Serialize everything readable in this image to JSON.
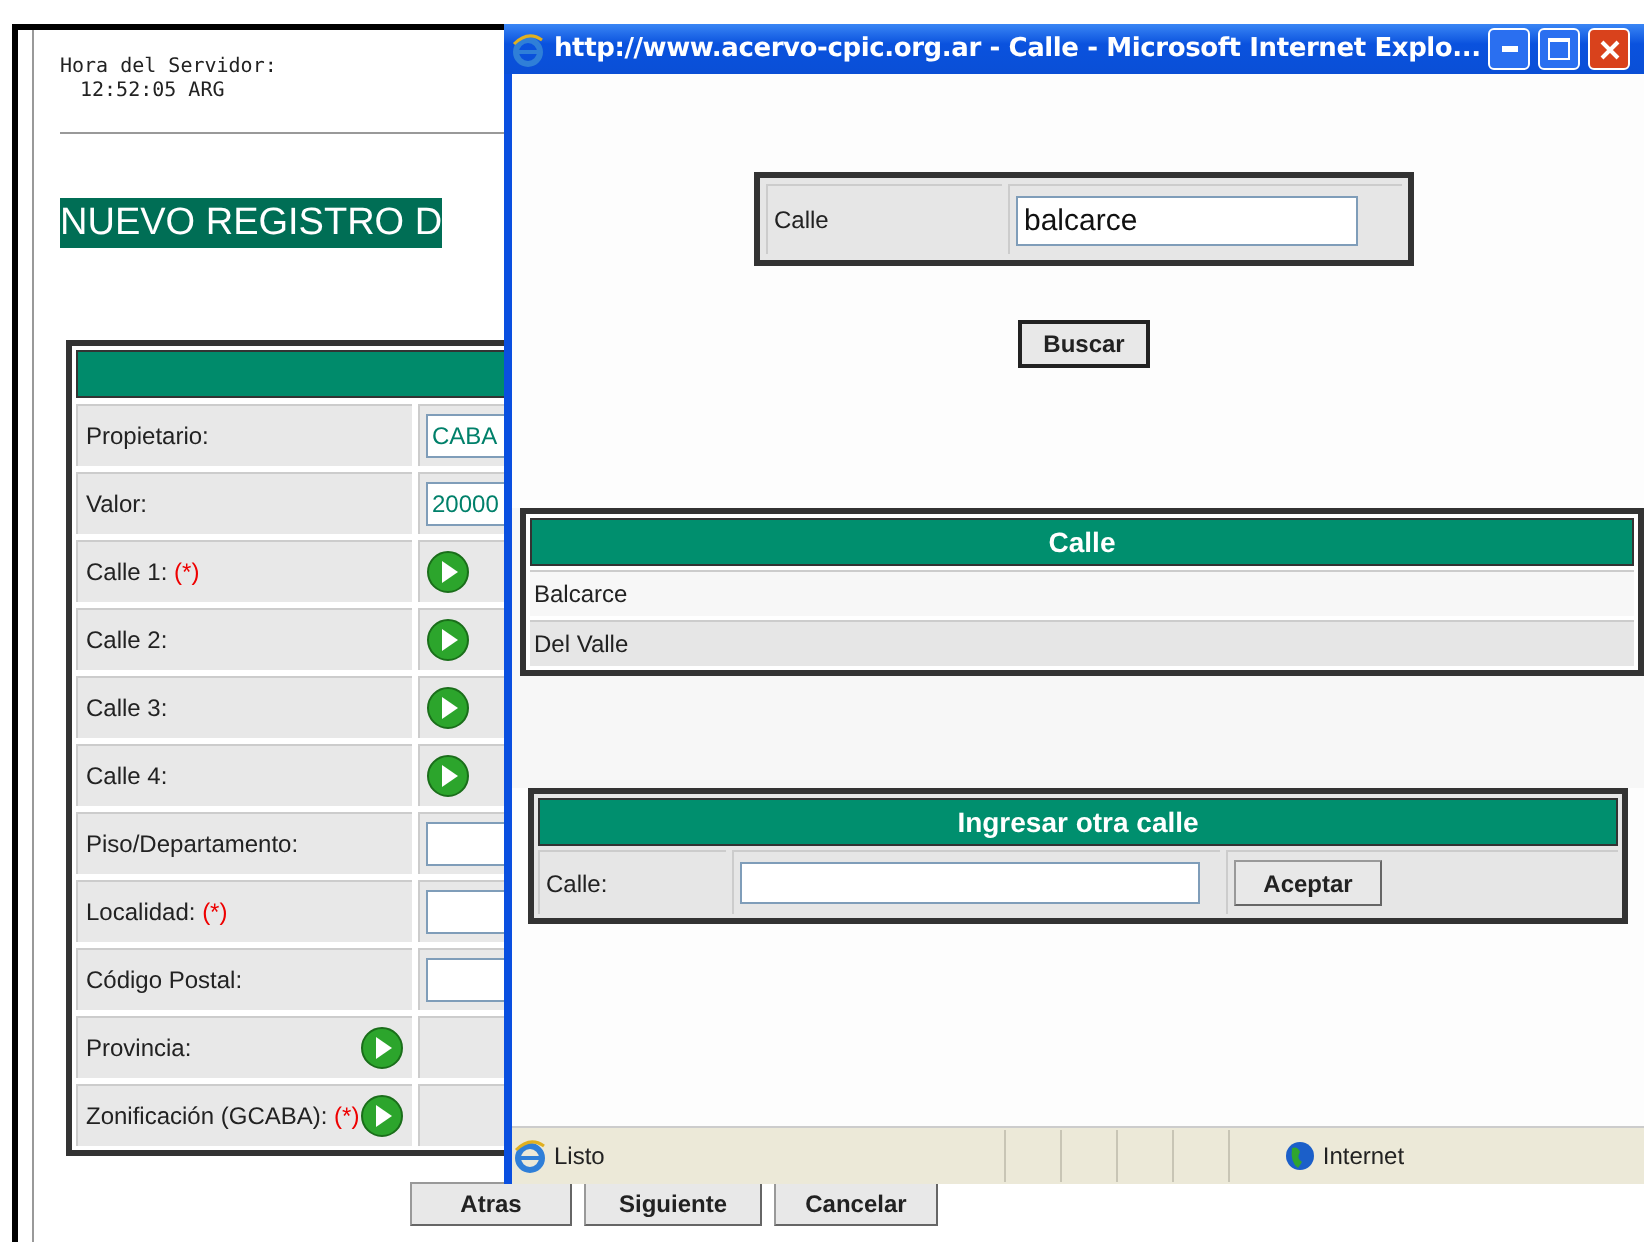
{
  "server_time": {
    "label": "Hora del Servidor:",
    "value": "12:52:05 ARG"
  },
  "page_title": "NUEVO REGISTRO D",
  "form": {
    "rows": [
      {
        "label": "Propietario:",
        "kind": "input",
        "value": "CABA"
      },
      {
        "label": "Valor:",
        "kind": "input",
        "value": "20000"
      },
      {
        "label": "Calle 1:",
        "mark": "(*)",
        "kind": "go"
      },
      {
        "label": "Calle 2:",
        "kind": "go"
      },
      {
        "label": "Calle 3:",
        "kind": "go"
      },
      {
        "label": "Calle 4:",
        "kind": "go"
      },
      {
        "label": "Piso/Departamento:",
        "kind": "input"
      },
      {
        "label": "Localidad:",
        "mark": "(*)",
        "kind": "input"
      },
      {
        "label": "Código Postal:",
        "kind": "input"
      },
      {
        "label": "Provincia:",
        "kind": "label-go"
      },
      {
        "label": "Zonificación (GCABA):",
        "mark": "(*)",
        "kind": "label-go"
      }
    ]
  },
  "buttons": [
    "Atras",
    "Siguiente",
    "Cancelar"
  ],
  "popup": {
    "title": "http://www.acervo-cpic.org.ar - Calle - Microsoft Internet Explo...",
    "search": {
      "label": "Calle",
      "value": "balcarce",
      "button": "Buscar"
    },
    "results": {
      "header": "Calle",
      "rows": [
        "Balcarce",
        "Del Valle"
      ]
    },
    "new_street": {
      "header": "Ingresar otra calle",
      "label": "Calle:",
      "button": "Aceptar"
    },
    "status": {
      "text": "Listo",
      "zone": "Internet"
    }
  }
}
